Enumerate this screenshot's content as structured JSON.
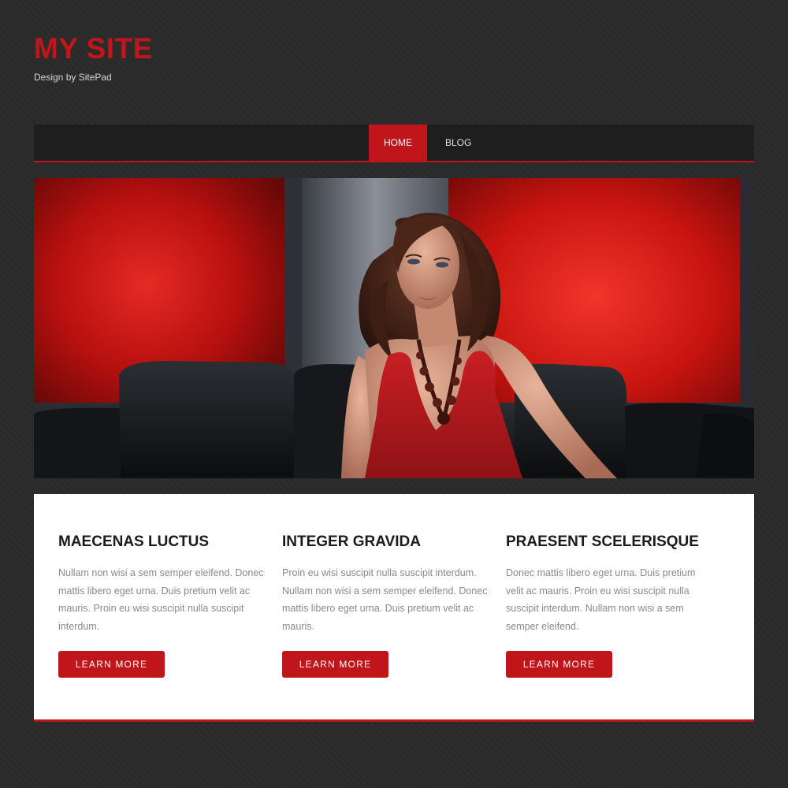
{
  "header": {
    "title": "MY SITE",
    "tagline": "Design by SitePad"
  },
  "nav": {
    "items": [
      {
        "label": "HOME",
        "active": true
      },
      {
        "label": "BLOG",
        "active": false
      }
    ]
  },
  "hero": {
    "image": "woman-in-red-dress-on-black-leather-sofa"
  },
  "columns": [
    {
      "heading": "MAECENAS LUCTUS",
      "text": "Nullam non wisi a sem semper eleifend. Donec mattis libero eget urna. Duis pretium velit ac mauris. Proin eu wisi suscipit nulla suscipit interdum.",
      "button": "LEARN MORE"
    },
    {
      "heading": "INTEGER GRAVIDA",
      "text": "Proin eu wisi suscipit nulla suscipit interdum. Nullam non wisi a sem semper eleifend. Donec mattis libero eget urna. Duis pretium velit ac mauris.",
      "button": "LEARN MORE"
    },
    {
      "heading": "PRAESENT SCELERISQUE",
      "text": "Donec mattis libero eget urna. Duis pretium velit ac mauris. Proin eu wisi suscipit nulla suscipit interdum. Nullam non wisi a sem semper eleifend.",
      "button": "LEARN MORE"
    }
  ],
  "colors": {
    "accent": "#c0161b",
    "background": "#2a2a2a",
    "navbar": "#1e1e1e"
  }
}
